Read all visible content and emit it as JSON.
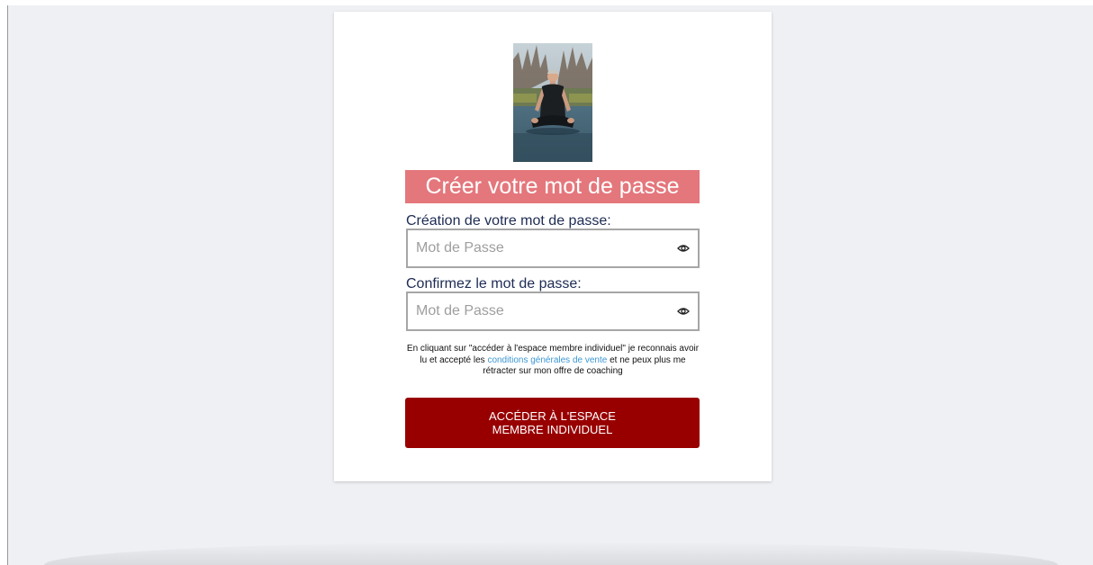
{
  "form": {
    "title": "Créer votre mot de passe",
    "password": {
      "label": "Création de votre mot de passe:",
      "placeholder": "Mot de Passe",
      "value": "",
      "icon": "eye-icon"
    },
    "confirm": {
      "label": "Confirmez le mot de passe:",
      "placeholder": "Mot de Passe",
      "value": "",
      "icon": "eye-icon"
    },
    "legal": {
      "before": "En cliquant sur \"accéder à l'espace membre individuel\" je reconnais avoir lu et accepté les ",
      "link": "conditions générales de vente",
      "after": " et ne peux plus me rétracter sur mon offre de coaching"
    },
    "submit": {
      "line1": "ACCÉDER À L'ESPACE",
      "line2": "MEMBRE INDIVIDUEL"
    }
  },
  "colors": {
    "page_bg": "#eff0f4",
    "banner": "#e4777c",
    "label_text": "#1d2b54",
    "link": "#3c97d3",
    "button": "#980000"
  }
}
